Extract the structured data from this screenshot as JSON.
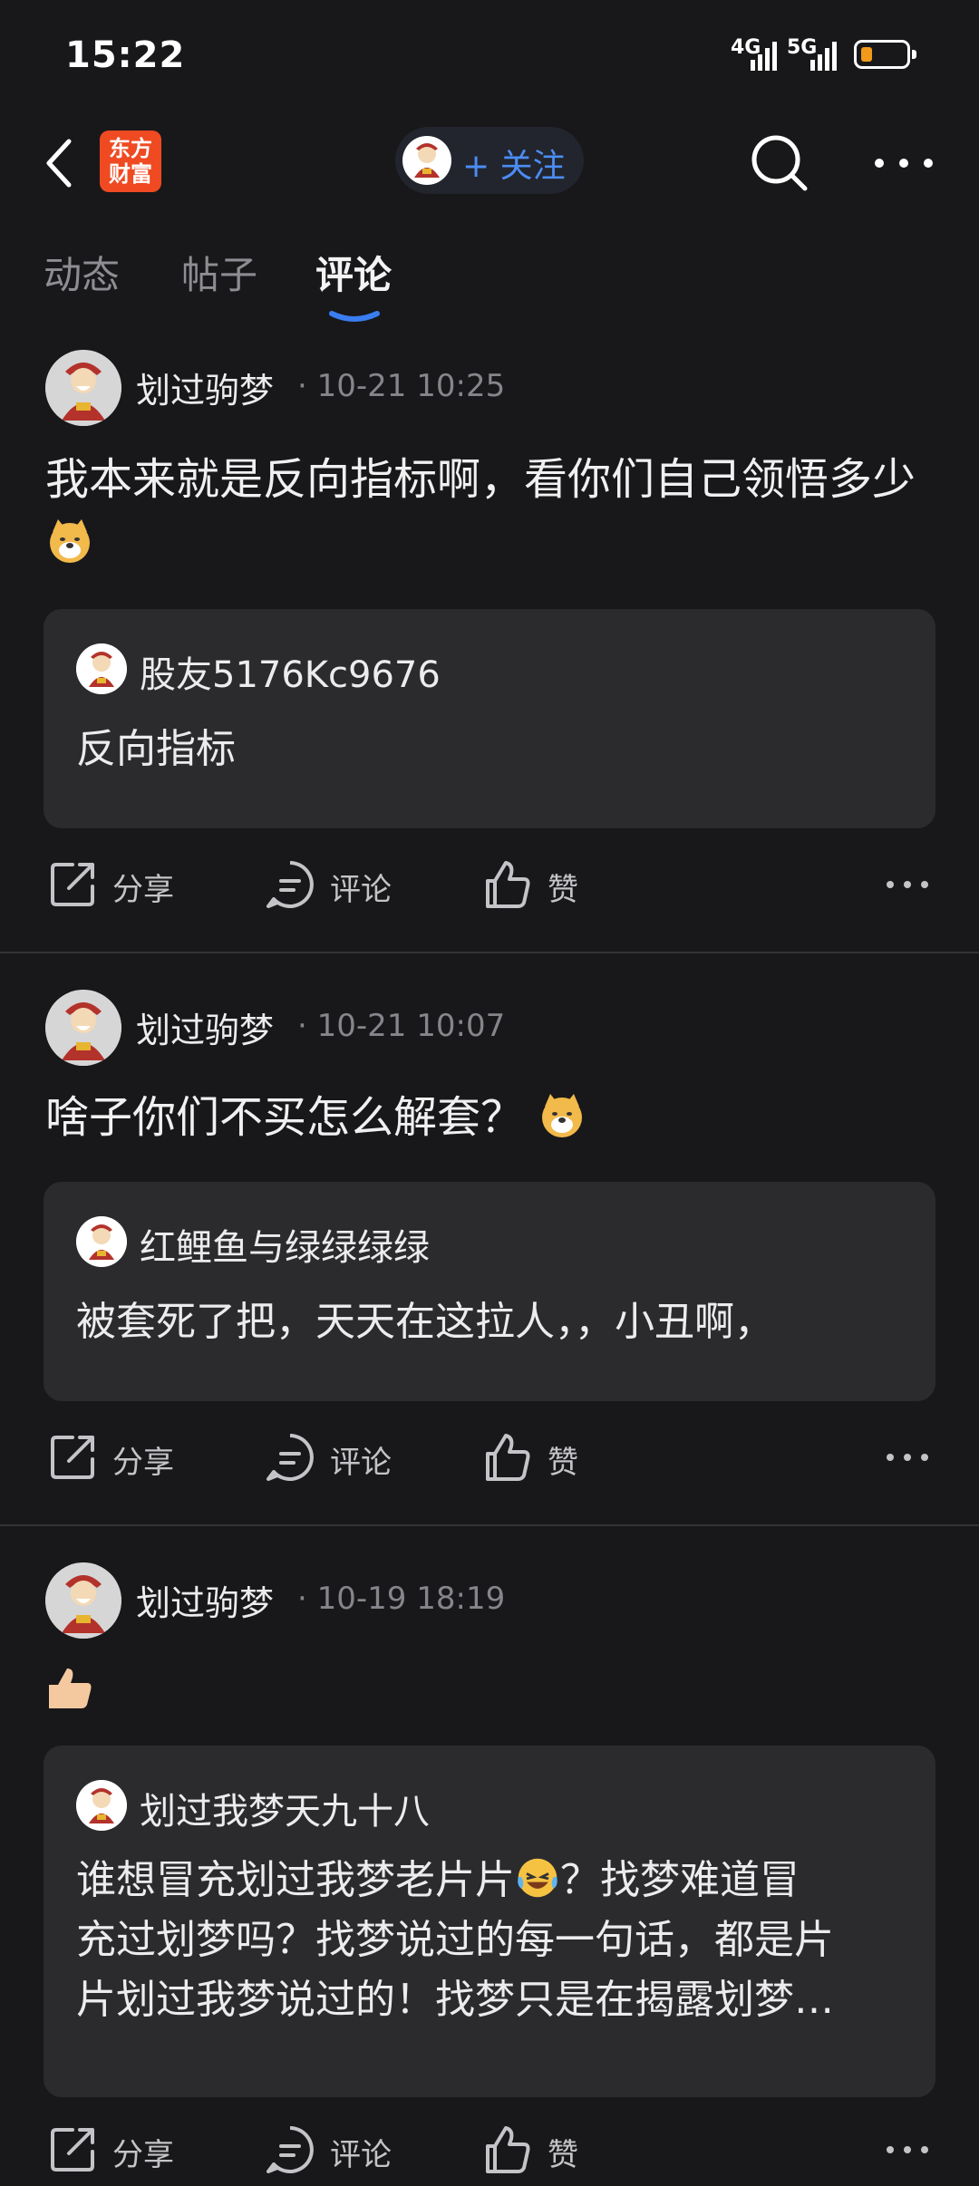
{
  "status_bar": {
    "time": "15:22",
    "net1": "4G",
    "net2": "5G"
  },
  "header": {
    "logo_line1": "东方",
    "logo_line2": "财富",
    "follow_label": "+ 关注"
  },
  "tabs": [
    {
      "label": "动态",
      "active": false
    },
    {
      "label": "帖子",
      "active": false
    },
    {
      "label": "评论",
      "active": true
    }
  ],
  "posts": [
    {
      "author": "划过驹梦",
      "meta": "· 10-21 10:25",
      "text": "我本来就是反向指标啊，看你们自己领悟多少",
      "emoji": "doge-emoji",
      "quote": {
        "user": "股友5176Kc9676",
        "text": "反向指标"
      },
      "actions": {
        "share": "分享",
        "comment": "评论",
        "like": "赞"
      }
    },
    {
      "author": "划过驹梦",
      "meta": "· 10-21 10:07",
      "text": "啥子你们不买怎么解套？",
      "emoji": "doge-emoji",
      "quote": {
        "user": "红鲤鱼与绿绿绿绿",
        "text": "被套死了把，天天在这拉人，，小丑啊，"
      },
      "actions": {
        "share": "分享",
        "comment": "评论",
        "like": "赞"
      }
    },
    {
      "author": "划过驹梦",
      "meta": "· 10-19 18:19",
      "text": "",
      "emoji": "thumbs-up-emoji",
      "quote": {
        "user": "划过我梦天九十八",
        "text_lines": [
          "谁想冒充划过我梦老片片",
          "？找梦难道冒",
          "充过划梦吗？找梦说过的每一句话，都是片",
          "片划过我梦说过的！找梦只是在揭露划梦…"
        ]
      },
      "actions": {
        "share": "分享",
        "comment": "评论",
        "like": "赞"
      }
    }
  ]
}
